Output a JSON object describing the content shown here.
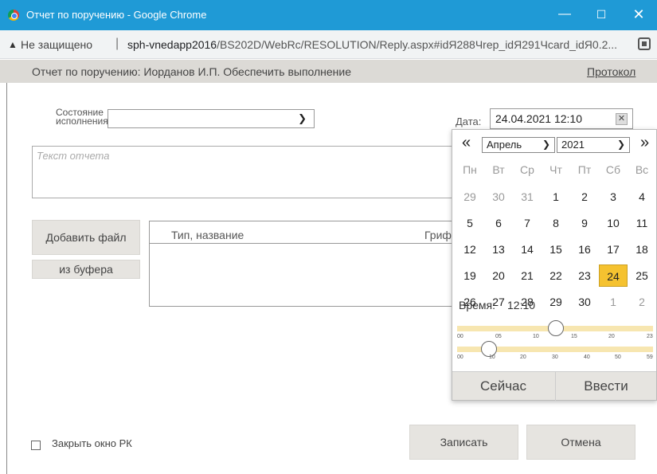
{
  "window": {
    "title": "Отчет по поручению - Google Chrome",
    "min_glyph": "—",
    "max_glyph": "☐",
    "close_glyph": "✕"
  },
  "address": {
    "warn_glyph": "▲",
    "insecure_label": "Не защищено",
    "separator": "|",
    "url_host": "sph-vnedapp2016",
    "url_path": "/BS202D/WebRc/RESOLUTION/Reply.aspx#idЯ288Чrep_idЯ291Чcard_idЯ0.2..."
  },
  "header": {
    "title": "Отчет по поручению: Иорданов И.П. Обеспечить выполнение",
    "protocol_link": "Протокол"
  },
  "form": {
    "state_label": "Состояние исполнения:",
    "state_value": "",
    "report_placeholder": "Текст отчета",
    "add_file_label": "Добавить файл",
    "from_buffer_label": "из буфера",
    "files_columns": [
      "Тип, название",
      "Гриф"
    ],
    "close_checkbox_label": "Закрыть окно РК",
    "close_checked": false,
    "save_label": "Записать",
    "cancel_label": "Отмена",
    "date_label": "Дата:",
    "date_value": "24.04.2021 12:10",
    "date_clear_glyph": "✕"
  },
  "calendar": {
    "prev_glyph": "«",
    "next_glyph": "»",
    "month": "Апрель",
    "year": "2021",
    "weekdays": [
      "Пн",
      "Вт",
      "Ср",
      "Чт",
      "Пт",
      "Сб",
      "Вс"
    ],
    "weeks": [
      [
        {
          "d": "29",
          "other": true
        },
        {
          "d": "30",
          "other": true
        },
        {
          "d": "31",
          "other": true
        },
        {
          "d": "1"
        },
        {
          "d": "2"
        },
        {
          "d": "3"
        },
        {
          "d": "4"
        }
      ],
      [
        {
          "d": "5"
        },
        {
          "d": "6"
        },
        {
          "d": "7"
        },
        {
          "d": "8"
        },
        {
          "d": "9"
        },
        {
          "d": "10"
        },
        {
          "d": "11"
        }
      ],
      [
        {
          "d": "12"
        },
        {
          "d": "13"
        },
        {
          "d": "14"
        },
        {
          "d": "15"
        },
        {
          "d": "16"
        },
        {
          "d": "17"
        },
        {
          "d": "18"
        }
      ],
      [
        {
          "d": "19"
        },
        {
          "d": "20"
        },
        {
          "d": "21"
        },
        {
          "d": "22"
        },
        {
          "d": "23"
        },
        {
          "d": "24",
          "selected": true
        },
        {
          "d": "25"
        }
      ],
      [
        {
          "d": "26"
        },
        {
          "d": "27"
        },
        {
          "d": "28"
        },
        {
          "d": "29"
        },
        {
          "d": "30"
        },
        {
          "d": "1",
          "other": true
        },
        {
          "d": "2",
          "other": true
        }
      ]
    ],
    "time_label": "Время:",
    "time_value": "12:10",
    "hour_value": 12,
    "minute_value": 10,
    "hour_ticks": [
      "00",
      "05",
      "10",
      "15",
      "20",
      "23"
    ],
    "minute_ticks": [
      "00",
      "10",
      "20",
      "30",
      "40",
      "50",
      "59"
    ],
    "now_label": "Сейчас",
    "enter_label": "Ввести"
  },
  "colors": {
    "titlebar": "#1f9ad6",
    "selected_day": "#f5c230",
    "header_bar": "#dcdad6"
  }
}
